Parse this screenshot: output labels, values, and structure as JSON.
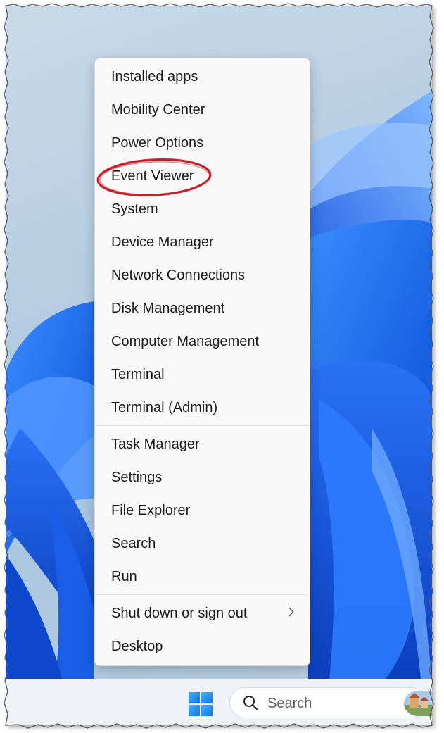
{
  "menu": {
    "items": [
      {
        "label": "Installed apps"
      },
      {
        "label": "Mobility Center"
      },
      {
        "label": "Power Options"
      },
      {
        "label": "Event Viewer"
      },
      {
        "label": "System"
      },
      {
        "label": "Device Manager"
      },
      {
        "label": "Network Connections"
      },
      {
        "label": "Disk Management"
      },
      {
        "label": "Computer Management"
      },
      {
        "label": "Terminal"
      },
      {
        "label": "Terminal (Admin)"
      },
      {
        "label": "Task Manager"
      },
      {
        "label": "Settings"
      },
      {
        "label": "File Explorer"
      },
      {
        "label": "Search"
      },
      {
        "label": "Run"
      },
      {
        "label": "Shut down or sign out"
      },
      {
        "label": "Desktop"
      }
    ],
    "highlighted_item": "Event Viewer",
    "submenu_icon": "chevron-right-icon"
  },
  "taskbar": {
    "start_icon": "windows-logo-icon",
    "search": {
      "icon": "search-icon",
      "placeholder": "Search"
    },
    "avatar_icon": "avatar"
  },
  "colors": {
    "highlight_ellipse": "#c8202a",
    "accent_blue": "#1a6ff0",
    "menu_bg": "#f9f9f9",
    "text": "#1b1b1b"
  }
}
